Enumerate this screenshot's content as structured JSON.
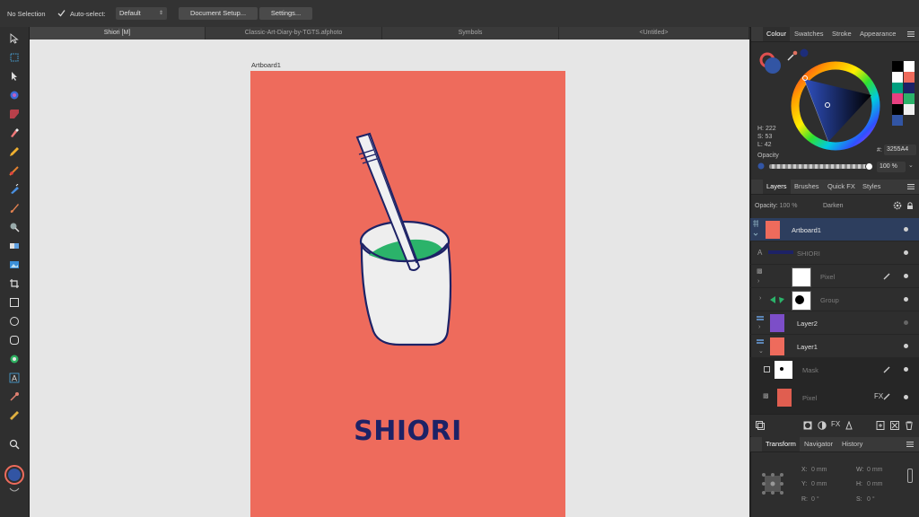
{
  "context_bar": {
    "selection_status": "No Selection",
    "autoselect_label": "Auto-select:",
    "autoselect_value": "Default",
    "document_setup_label": "Document Setup...",
    "settings_label": "Settings..."
  },
  "doc_tabs": [
    {
      "label": "Shiori [M]",
      "active": true
    },
    {
      "label": "Classic-Art-Diary-by-TGTS.afphoto",
      "active": false
    },
    {
      "label": "Symbols",
      "active": false
    },
    {
      "label": "<Untitled>",
      "active": false
    }
  ],
  "canvas": {
    "artboard_label": "Artboard1",
    "artwork_title": "SHIORI",
    "artboard_color": "#ee6b5c",
    "title_color": "#1d2266"
  },
  "colour_panel": {
    "tabs": [
      "Colour",
      "Swatches",
      "Stroke",
      "Appearance"
    ],
    "h": "H: 222",
    "s": "S: 53",
    "l": "L: 42",
    "hex_prefix": "#:",
    "hex": "3255A4",
    "opacity_label": "Opacity",
    "opacity_value": "100 %",
    "fill_color": "#3255a4"
  },
  "layers_panel": {
    "tabs": [
      "Layers",
      "Brushes",
      "Quick FX",
      "Styles"
    ],
    "opacity_label": "Opacity:",
    "opacity_value": "100 %",
    "blend_mode": "Darken",
    "layers": [
      {
        "name": "Artboard1",
        "selected": true
      },
      {
        "name": "SHIORI",
        "selected": false
      },
      {
        "name": "Pixel",
        "selected": false
      },
      {
        "name": "Group",
        "selected": false
      },
      {
        "name": "Layer2",
        "selected": false
      },
      {
        "name": "Layer1",
        "selected": false
      },
      {
        "name": "Mask",
        "selected": false
      },
      {
        "name": "Pixel",
        "selected": false
      }
    ]
  },
  "transform_panel": {
    "tabs": [
      "Transform",
      "Navigator",
      "History"
    ],
    "x_label": "X:",
    "x_value": "0 mm",
    "y_label": "Y:",
    "y_value": "0 mm",
    "w_label": "W:",
    "w_value": "0 mm",
    "h_label": "H:",
    "h_value": "0 mm",
    "r_label": "R:",
    "r_value": "0 °",
    "s_label": "S:",
    "s_value": "0 °"
  }
}
